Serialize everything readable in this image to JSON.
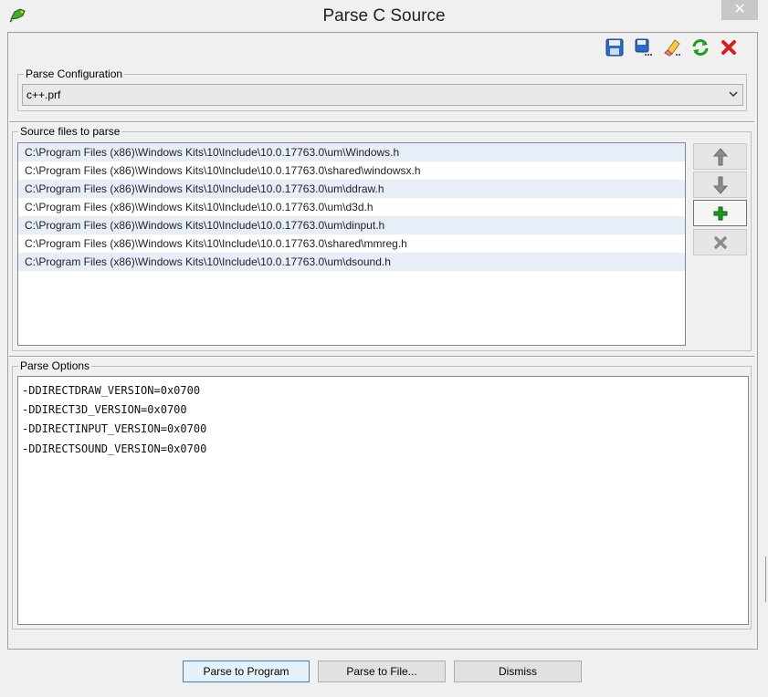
{
  "window": {
    "title": "Parse C Source",
    "close_glyph": "✕"
  },
  "toolbar": {
    "icons": [
      "save-icon",
      "save-as-icon",
      "clear-icon",
      "refresh-icon",
      "delete-icon"
    ]
  },
  "parse_configuration": {
    "legend": "Parse Configuration",
    "selected": "c++.prf"
  },
  "source_files": {
    "legend": "Source files to parse",
    "items": [
      "C:\\Program Files (x86)\\Windows Kits\\10\\Include\\10.0.17763.0\\um\\Windows.h",
      "C:\\Program Files (x86)\\Windows Kits\\10\\Include\\10.0.17763.0\\shared\\windowsx.h",
      "C:\\Program Files (x86)\\Windows Kits\\10\\Include\\10.0.17763.0\\um\\ddraw.h",
      "C:\\Program Files (x86)\\Windows Kits\\10\\Include\\10.0.17763.0\\um\\d3d.h",
      "C:\\Program Files (x86)\\Windows Kits\\10\\Include\\10.0.17763.0\\um\\dinput.h",
      "C:\\Program Files (x86)\\Windows Kits\\10\\Include\\10.0.17763.0\\shared\\mmreg.h",
      "C:\\Program Files (x86)\\Windows Kits\\10\\Include\\10.0.17763.0\\um\\dsound.h"
    ],
    "side_buttons": [
      "move-up-icon",
      "move-down-icon",
      "add-icon",
      "remove-icon"
    ]
  },
  "parse_options": {
    "legend": "Parse Options",
    "lines": [
      "-DDIRECTDRAW_VERSION=0x0700",
      "-DDIRECT3D_VERSION=0x0700",
      "-DDIRECTINPUT_VERSION=0x0700",
      "-DDIRECTSOUND_VERSION=0x0700"
    ]
  },
  "buttons": {
    "parse_to_program": "Parse to Program",
    "parse_to_file": "Parse to File...",
    "dismiss": "Dismiss"
  },
  "colors": {
    "accent_green": "#1e9e1e",
    "delete_red": "#d22020",
    "save_blue": "#2a6bc9"
  }
}
